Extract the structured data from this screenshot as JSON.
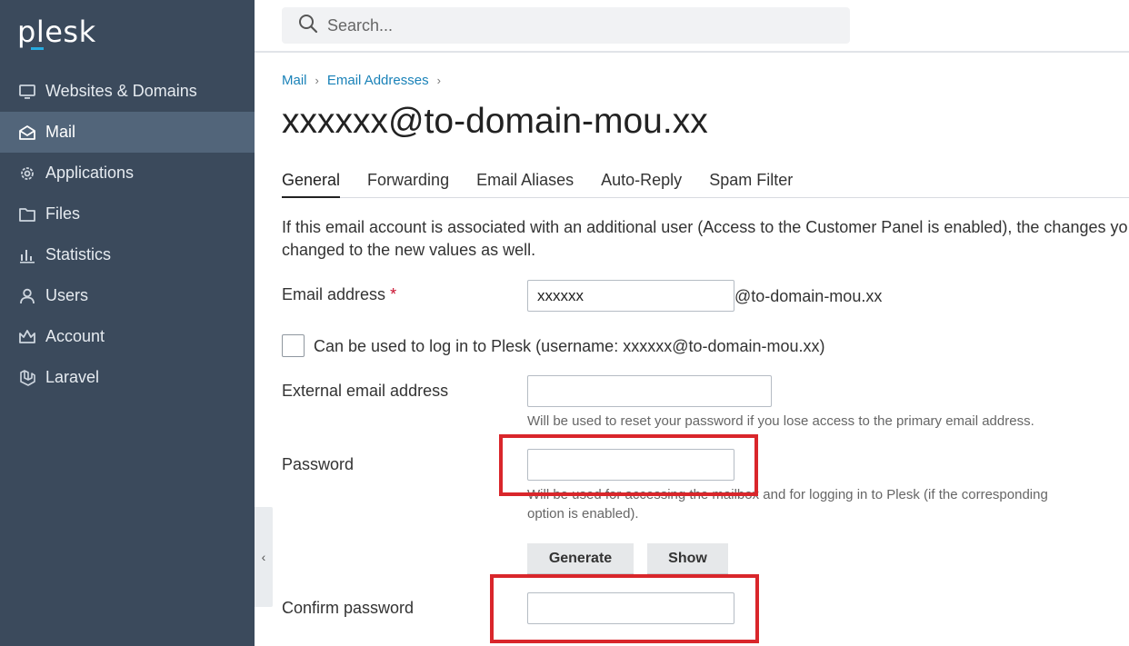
{
  "brand": {
    "logo_text": "plesk"
  },
  "sidebar": {
    "items": [
      {
        "label": "Websites & Domains",
        "icon": "monitor-icon",
        "active": false
      },
      {
        "label": "Mail",
        "icon": "envelope-icon",
        "active": true
      },
      {
        "label": "Applications",
        "icon": "gear-icon",
        "active": false
      },
      {
        "label": "Files",
        "icon": "folder-icon",
        "active": false
      },
      {
        "label": "Statistics",
        "icon": "bar-chart-icon",
        "active": false
      },
      {
        "label": "Users",
        "icon": "user-icon",
        "active": false
      },
      {
        "label": "Account",
        "icon": "crown-icon",
        "active": false
      },
      {
        "label": "Laravel",
        "icon": "laravel-icon",
        "active": false
      }
    ],
    "collapse_glyph": "‹"
  },
  "search": {
    "placeholder": "Search..."
  },
  "breadcrumb": {
    "items": [
      "Mail",
      "Email Addresses"
    ],
    "separator": "›"
  },
  "page": {
    "title": "xxxxxx@to-domain-mou.xx"
  },
  "tabs": [
    "General",
    "Forwarding",
    "Email Aliases",
    "Auto-Reply",
    "Spam Filter"
  ],
  "info": {
    "line1": "If this email account is associated with an additional user (Access to the Customer Panel is enabled), the changes yo",
    "line2": "changed to the new values as well."
  },
  "form": {
    "email": {
      "label": "Email address",
      "required_mark": "*",
      "value": "xxxxxx",
      "suffix": "@to-domain-mou.xx"
    },
    "login_checkbox": {
      "label": "Can be used to log in to Plesk  (username: xxxxxx@to-domain-mou.xx)",
      "checked": false
    },
    "external_email": {
      "label": "External email address",
      "value": "",
      "hint": "Will be used to reset your password if you lose access to the primary email address."
    },
    "password": {
      "label": "Password",
      "value": "",
      "hint_line1": "Will be used for accessing the mailbox and for logging in to Plesk (if the corresponding",
      "hint_line2": "option is enabled)."
    },
    "buttons": {
      "generate": "Generate",
      "show": "Show"
    },
    "confirm_password": {
      "label": "Confirm password",
      "value": ""
    }
  },
  "colors": {
    "sidebar_bg": "#3b4a5c",
    "sidebar_active": "#52657a",
    "link": "#1a82b8",
    "highlight": "#d9262b"
  }
}
